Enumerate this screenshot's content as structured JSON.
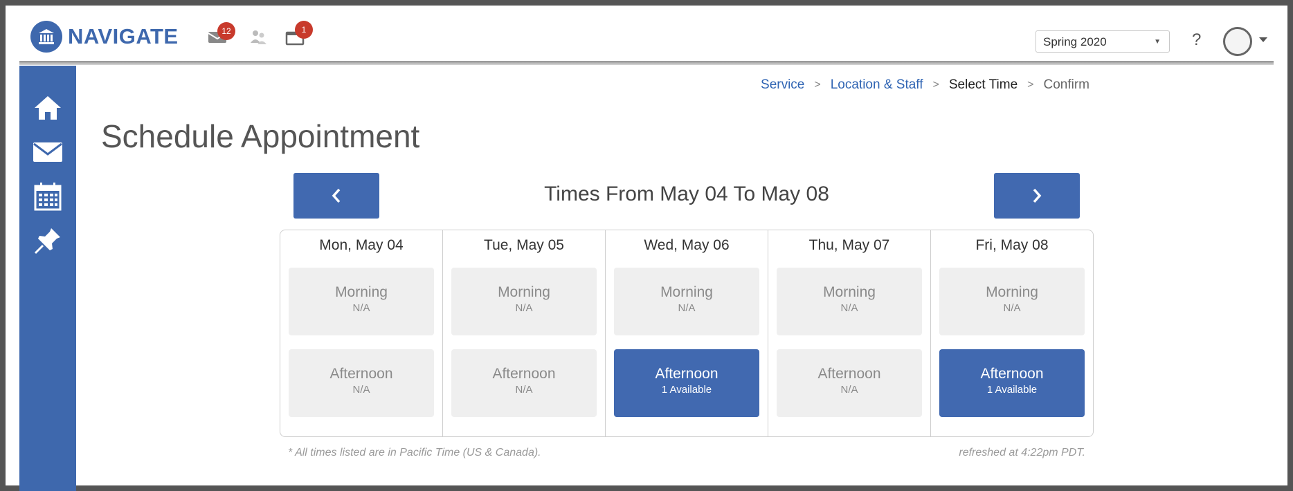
{
  "app": {
    "name": "NAVIGATE"
  },
  "header": {
    "messages_badge": "12",
    "notifications_badge": "1",
    "term_selected": "Spring 2020",
    "help_label": "?"
  },
  "breadcrumb": {
    "items": [
      {
        "label": "Service",
        "state": "link"
      },
      {
        "label": "Location & Staff",
        "state": "link"
      },
      {
        "label": "Select Time",
        "state": "current"
      },
      {
        "label": "Confirm",
        "state": "upcoming"
      }
    ],
    "separator": ">"
  },
  "page": {
    "title": "Schedule Appointment",
    "range_title": "Times From May 04 To May 08",
    "prev_label": "‹",
    "next_label": "›"
  },
  "days": [
    {
      "label": "Mon, May 04",
      "morning": {
        "name": "Morning",
        "avail": "N/A"
      },
      "afternoon": {
        "name": "Afternoon",
        "avail": "N/A"
      }
    },
    {
      "label": "Tue, May 05",
      "morning": {
        "name": "Morning",
        "avail": "N/A"
      },
      "afternoon": {
        "name": "Afternoon",
        "avail": "N/A"
      }
    },
    {
      "label": "Wed, May 06",
      "morning": {
        "name": "Morning",
        "avail": "N/A"
      },
      "afternoon": {
        "name": "Afternoon",
        "avail": "1 Available"
      }
    },
    {
      "label": "Thu, May 07",
      "morning": {
        "name": "Morning",
        "avail": "N/A"
      },
      "afternoon": {
        "name": "Afternoon",
        "avail": "N/A"
      }
    },
    {
      "label": "Fri, May 08",
      "morning": {
        "name": "Morning",
        "avail": "N/A"
      },
      "afternoon": {
        "name": "Afternoon",
        "avail": "1 Available"
      }
    }
  ],
  "footer": {
    "timezone_note": "* All times listed are in Pacific Time (US & Canada).",
    "refreshed": "refreshed at 4:22pm PDT."
  },
  "sidebar": {
    "icons": [
      "home-icon",
      "mail-icon",
      "calendar-icon",
      "pin-icon"
    ]
  },
  "colors": {
    "brand": "#3e68ad",
    "available_slot": "#4169b0",
    "unavailable_slot": "#efefef",
    "badge": "#c83a2c",
    "link": "#2f64b3"
  }
}
